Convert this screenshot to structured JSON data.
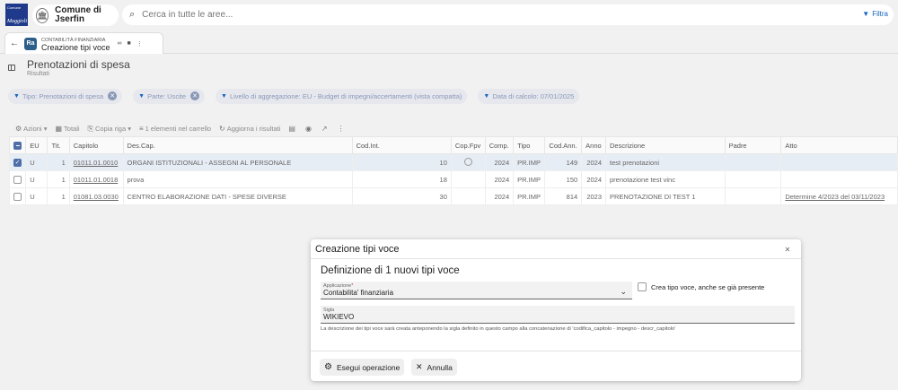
{
  "header": {
    "logo_text_top": "Comune",
    "logo_text_bottom": "Maggioli",
    "municipality": "Comune di Jserfin",
    "search_placeholder": "Cerca in tutte le aree...",
    "filter_label": "Filtra"
  },
  "tab": {
    "badge": "Ra",
    "module": "CONTABILITÀ FINANZIARIA",
    "title": "Creazione tipi voce"
  },
  "page": {
    "title": "Prenotazioni di spesa",
    "subtitle": "Risultati"
  },
  "filters": [
    {
      "label": "Tipo: Prenotazioni di spesa",
      "removable": true
    },
    {
      "label": "Parte: Uscite",
      "removable": true
    },
    {
      "label": "Livello di aggregazione: EU - Budget di impegni/accertamenti (vista compatta)",
      "removable": false
    },
    {
      "label": "Data di calcolo: 07/01/2025",
      "removable": false
    }
  ],
  "toolbar": {
    "azioni": "Azioni",
    "totali": "Totali",
    "copia_riga": "Copia riga",
    "carrello": "1 elementi nel carrello",
    "aggiorna": "Aggiorna i risultati"
  },
  "table": {
    "columns": [
      "EU",
      "Tit.",
      "Capitolo",
      "Des.Cap.",
      "Cod.Int.",
      "Cop.Fpv",
      "Comp.",
      "Tipo",
      "Cod.Ann.",
      "Anno",
      "Descrizione",
      "Padre",
      "Atto"
    ],
    "rows": [
      {
        "selected": true,
        "eu": "U",
        "tit": "1",
        "capitolo": "01011.01.0010",
        "descap": "ORGANI ISTITUZIONALI - ASSEGNI AL PERSONALE",
        "codint": "10",
        "copfpv": true,
        "comp": "2024",
        "tipo": "PR.IMP",
        "codann": "149",
        "anno": "2024",
        "descrizione": "test prenotazioni",
        "padre": "",
        "atto": ""
      },
      {
        "selected": false,
        "eu": "U",
        "tit": "1",
        "capitolo": "01011.01.0018",
        "descap": "prova",
        "codint": "18",
        "copfpv": false,
        "comp": "2024",
        "tipo": "PR.IMP",
        "codann": "150",
        "anno": "2024",
        "descrizione": "prenotazione test vinc",
        "padre": "",
        "atto": ""
      },
      {
        "selected": false,
        "eu": "U",
        "tit": "1",
        "capitolo": "01081.03.0030",
        "descap": "CENTRO ELABORAZIONE DATI - SPESE DIVERSE",
        "codint": "30",
        "copfpv": false,
        "comp": "2024",
        "tipo": "PR.IMP",
        "codann": "814",
        "anno": "2023",
        "descrizione": "PRENOTAZIONE DI TEST 1",
        "padre": "",
        "atto": "Determine 4/2023 del 03/11/2023"
      }
    ]
  },
  "dialog": {
    "title": "Creazione tipi voce",
    "subtitle": "Definizione di 1 nuovi tipi voce",
    "app_label": "Applicazione",
    "app_value": "Contabilita' finanziaria",
    "checkbox_label": "Crea tipo voce, anche se già presente",
    "sigla_label": "Sigla",
    "sigla_value": "WIKIEVO",
    "hint": "La descrizione dei tipi voce sarà creata anteponendo la sigla definito in questo campo alla concatenazione di 'codifica_capitolo - impegno - descr_capitolo'",
    "run_label": "Esegui operazione",
    "cancel_label": "Annulla"
  }
}
